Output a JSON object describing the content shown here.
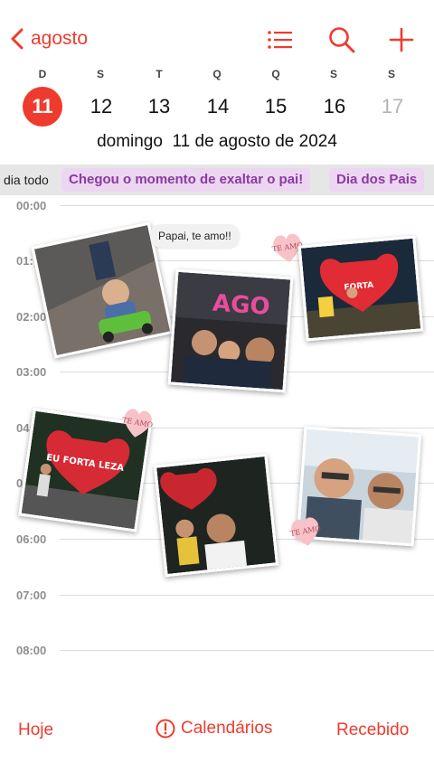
{
  "nav": {
    "back_label": "agosto",
    "icons": [
      "list-icon",
      "search-icon",
      "plus-icon"
    ]
  },
  "week": {
    "weekdays": [
      "D",
      "S",
      "T",
      "Q",
      "Q",
      "S",
      "S"
    ],
    "days": [
      "11",
      "12",
      "13",
      "14",
      "15",
      "16",
      "17"
    ],
    "selected_index": 0
  },
  "full_date": "domingo  11 de agosto de 2024",
  "all_day": {
    "label": "dia todo",
    "events": [
      "Chegou o momento de exaltar o pai!",
      "Dia dos Pais"
    ]
  },
  "hours": [
    "00:00",
    "01:",
    "02:00",
    "03:00",
    "04:",
    "0",
    "06:00",
    "07:00",
    "08:00"
  ],
  "stickers": {
    "bubble_text": "Papai, te amo!!",
    "heart_text": "TE AMO",
    "sign_letters_1": "AGO",
    "sign_letters_2": "EU FORTA LEZA"
  },
  "toolbar": {
    "today": "Hoje",
    "calendars": "Calendários",
    "inbox": "Recebido"
  },
  "colors": {
    "accent": "#ef3b2d",
    "event_bg": "#ecd6f1",
    "event_text": "#8b3aa0",
    "allday_bg": "#e6e6e6"
  }
}
